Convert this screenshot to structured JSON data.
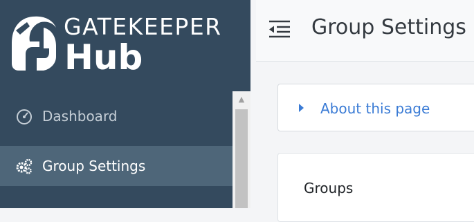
{
  "brand": {
    "line1": "GATEKEEPER",
    "line2": "Hub",
    "helmet_icon": "spartan-helmet-icon"
  },
  "sidebar": {
    "items": [
      {
        "label": "Dashboard",
        "icon": "tachometer-icon",
        "active": false
      },
      {
        "label": "Group Settings",
        "icon": "cogs-icon",
        "active": true
      }
    ]
  },
  "header": {
    "menu_icon": "menu-toggle-icon",
    "title": "Group Settings"
  },
  "main": {
    "about": {
      "label": "About this page",
      "icon": "caret-right-icon"
    },
    "groups": {
      "title": "Groups"
    }
  },
  "colors": {
    "sidebar_bg": "#344a5e",
    "sidebar_active_bg": "#4e6679",
    "link_blue": "#3a7bd5",
    "page_bg": "#f4f5f7"
  }
}
